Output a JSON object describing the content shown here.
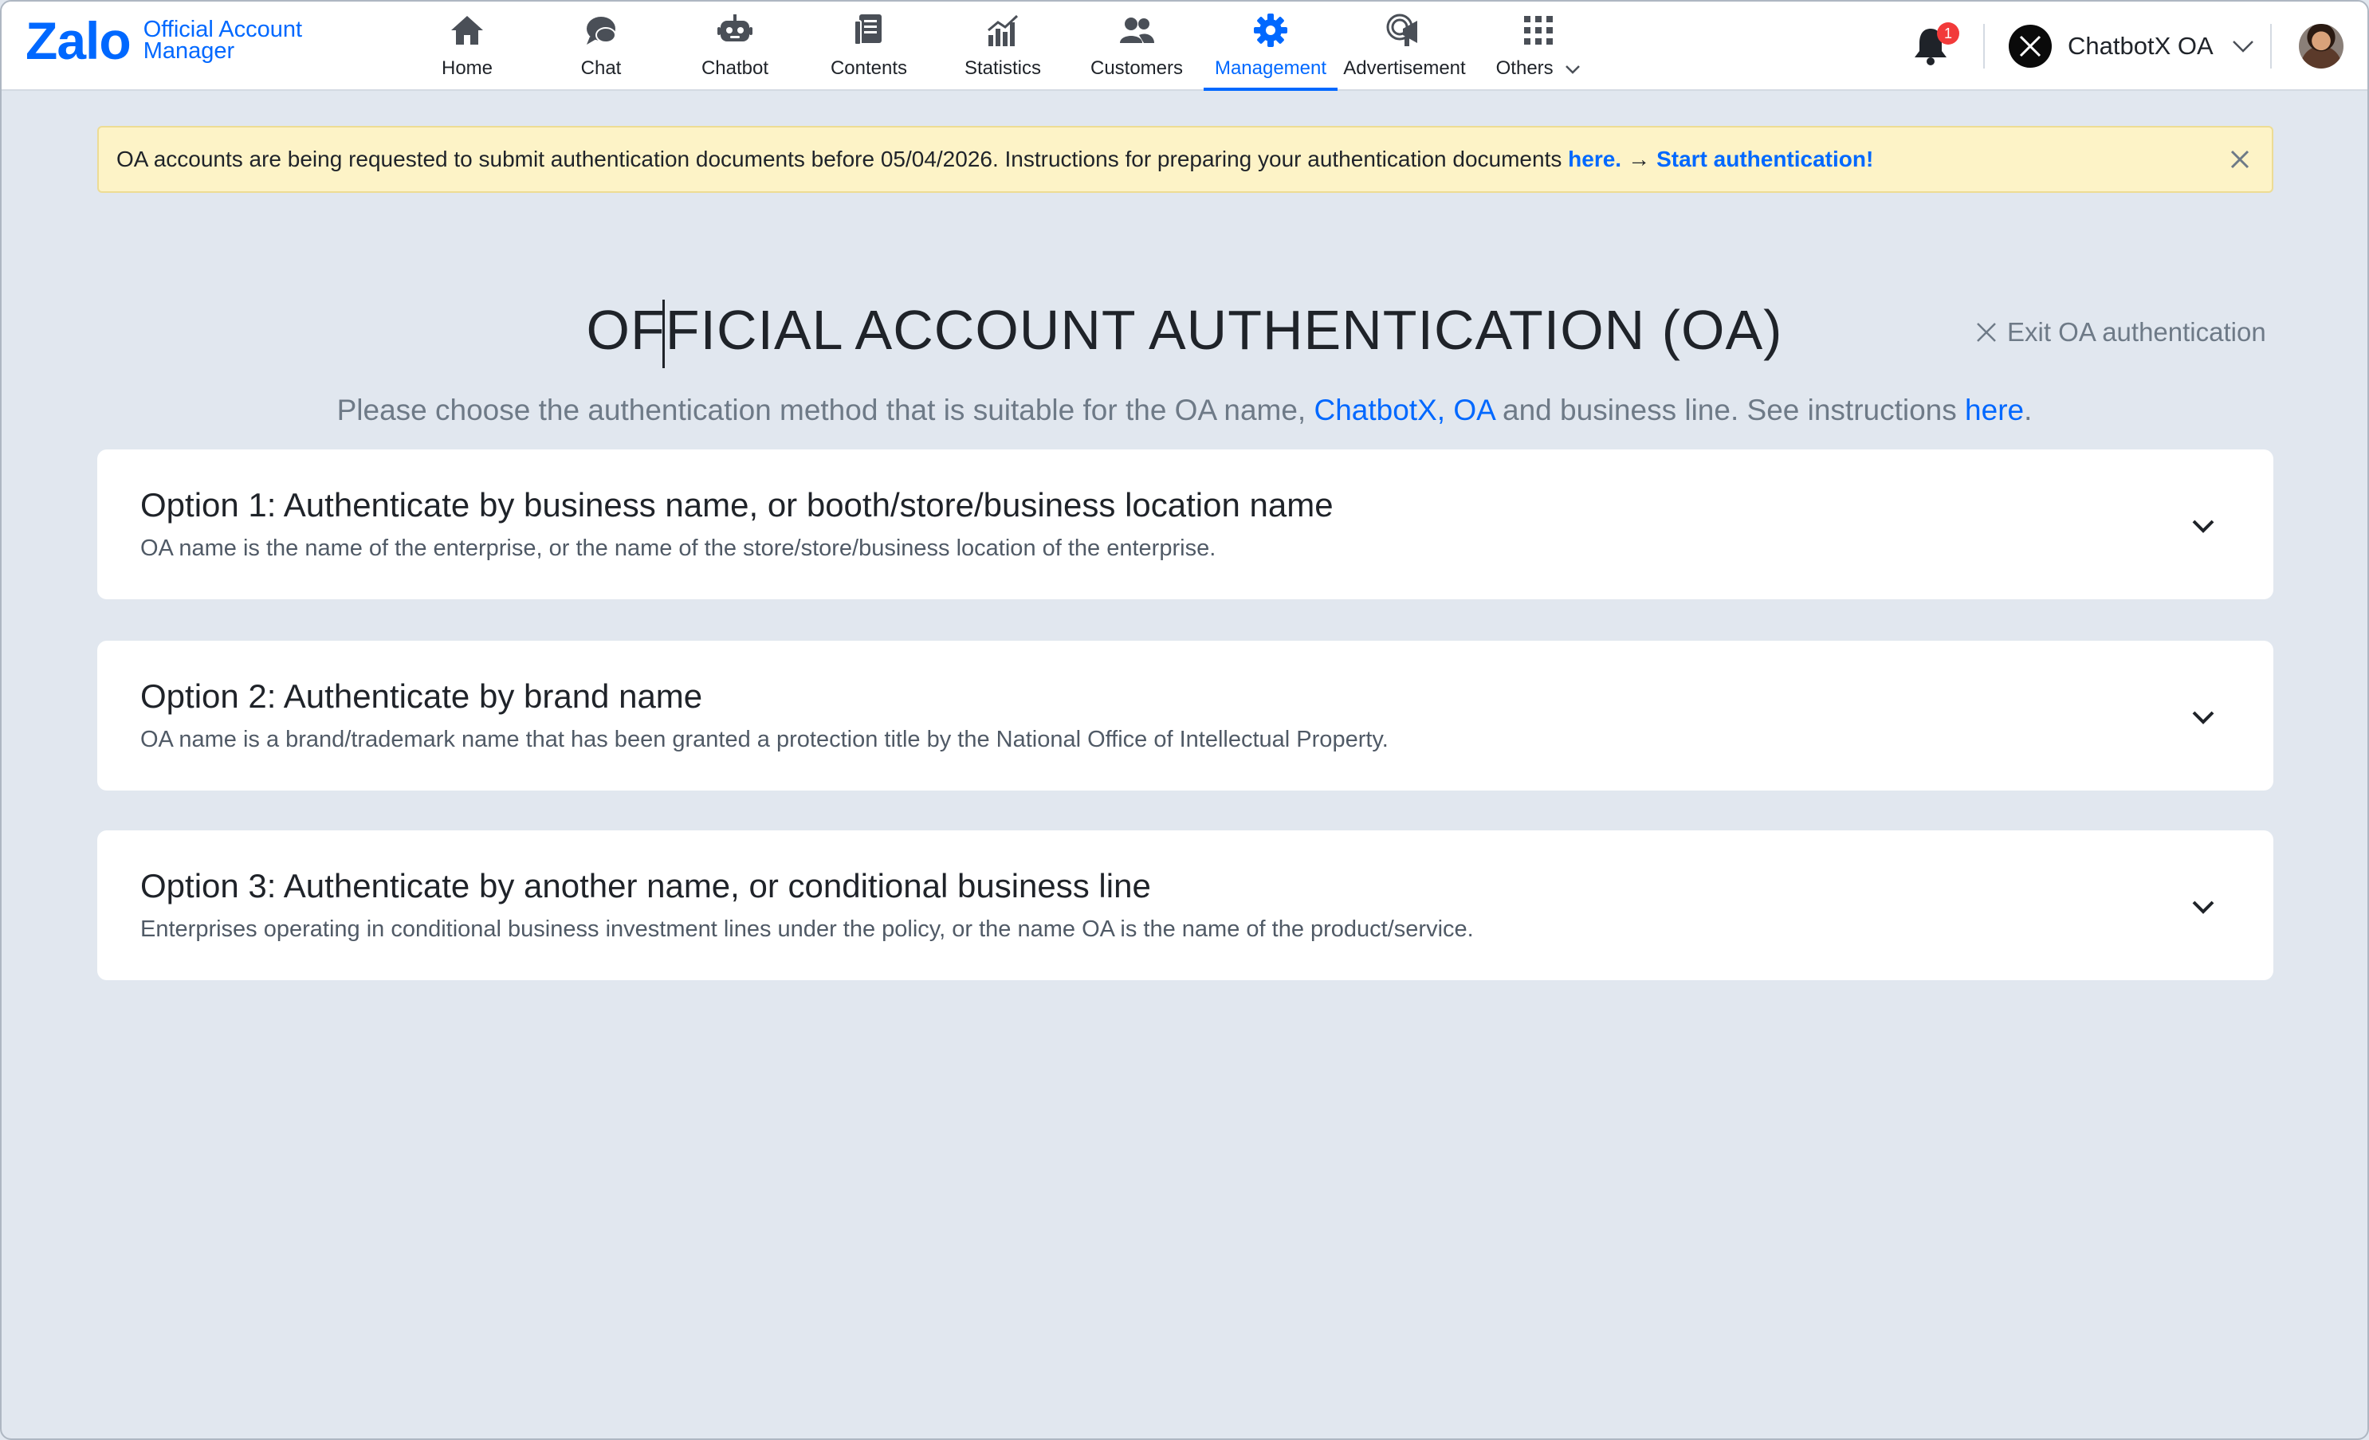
{
  "header": {
    "logo_main": "Zalo",
    "logo_sub_line1": "Official Account",
    "logo_sub_line2": "Manager",
    "nav": [
      {
        "label": "Home",
        "icon": "home-icon",
        "active": false
      },
      {
        "label": "Chat",
        "icon": "chat-icon",
        "active": false
      },
      {
        "label": "Chatbot",
        "icon": "chatbot-icon",
        "active": false
      },
      {
        "label": "Contents",
        "icon": "contents-icon",
        "active": false
      },
      {
        "label": "Statistics",
        "icon": "statistics-icon",
        "active": false
      },
      {
        "label": "Customers",
        "icon": "customers-icon",
        "active": false
      },
      {
        "label": "Management",
        "icon": "gear-icon",
        "active": true
      },
      {
        "label": "Advertisement",
        "icon": "megaphone-icon",
        "active": false
      },
      {
        "label": "Others",
        "icon": "grid-icon",
        "active": false
      }
    ],
    "notification_count": "1",
    "account_name": "ChatbotX OA"
  },
  "banner": {
    "text": "OA accounts are being requested to submit authentication documents before 05/04/2026. Instructions for preparing your authentication documents",
    "here_link": "here.",
    "arrow": "→",
    "start_link": "Start authentication!"
  },
  "page": {
    "title": "OFFICIAL ACCOUNT AUTHENTICATION (OA)",
    "exit_label": "Exit OA authentication",
    "subtitle_before": "Please choose the authentication method that is suitable for the OA name,",
    "subtitle_name": "ChatbotX, OA",
    "subtitle_middle": "and business line. See instructions",
    "subtitle_link": "here",
    "subtitle_end": "."
  },
  "options": [
    {
      "title": "Option 1: Authenticate by business name, or booth/store/business location name",
      "description": "OA name is the name of the enterprise, or the name of the store/store/business location of the enterprise."
    },
    {
      "title": "Option 2: Authenticate by brand name",
      "description": "OA name is a brand/trademark name that has been granted a protection title by the National Office of Intellectual Property."
    },
    {
      "title": "Option 3: Authenticate by another name, or conditional business line",
      "description": "Enterprises operating in conditional business investment lines under the policy, or the name OA is the name of the product/service."
    }
  ],
  "colors": {
    "brand_blue": "#0068ff",
    "banner_bg": "#fdf3c7",
    "page_bg": "#e1e7ef",
    "badge_red": "#f23a3a"
  }
}
